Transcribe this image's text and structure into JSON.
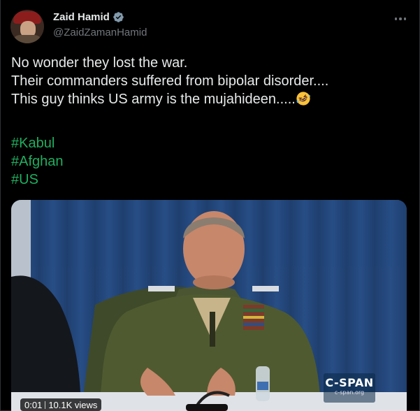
{
  "author": {
    "name": "Zaid Hamid",
    "handle": "@ZaidZamanHamid",
    "verified": true
  },
  "tweet": {
    "lines": [
      "No wonder they lost the war.",
      "Their commanders suffered from bipolar disorder....",
      "This guy thinks US army is the mujahideen....."
    ],
    "emoji": "rolling-on-floor-laughing",
    "hashtags": [
      "#Kabul",
      "#Afghan",
      "#US"
    ]
  },
  "media": {
    "type": "video",
    "time": "0:01",
    "views": "10.1K views",
    "watermark": {
      "title": "C-SPAN",
      "url": "c-span.org"
    }
  },
  "colors": {
    "background": "#000000",
    "text": "#e7e9ea",
    "secondary": "#71767b",
    "hashtag": "#1fae5f",
    "verified": "#829aab"
  }
}
